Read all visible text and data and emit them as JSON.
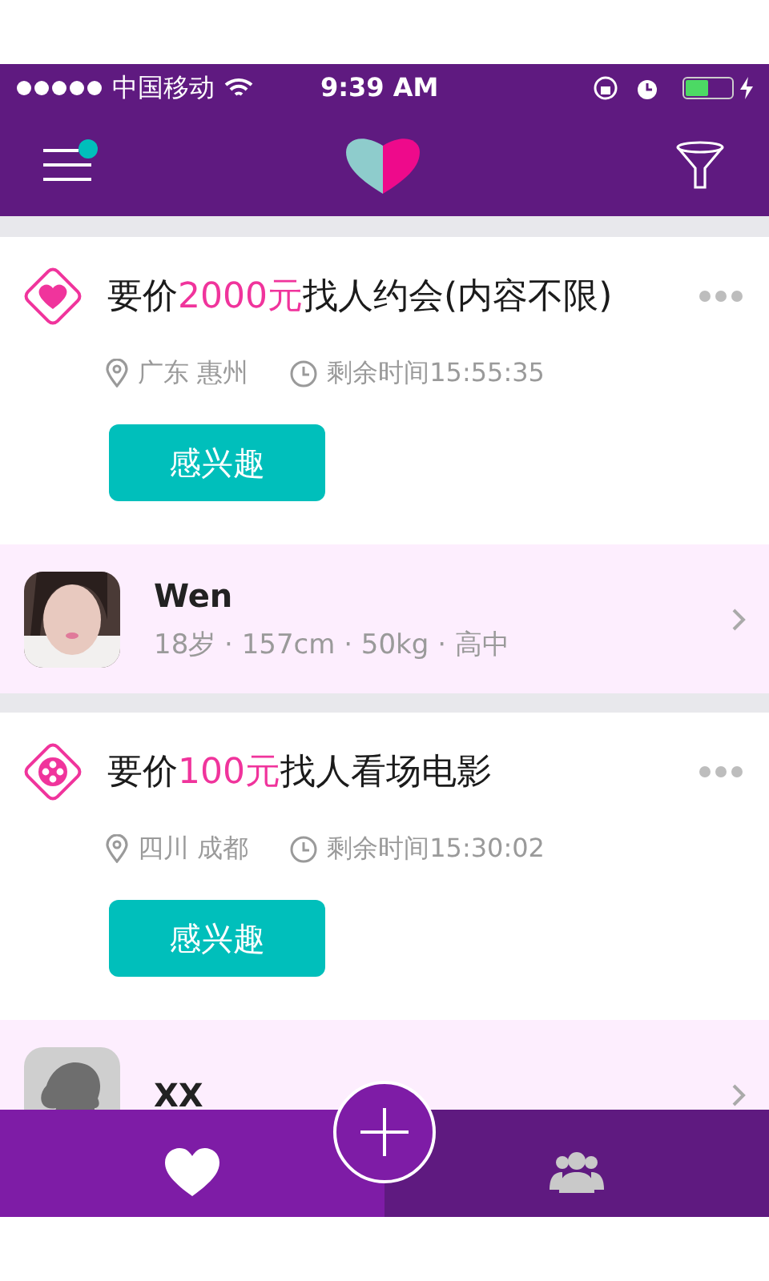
{
  "status_bar": {
    "carrier": "中国移动",
    "time": "9:39 AM"
  },
  "header": {
    "menu_badge": true
  },
  "posts": [
    {
      "kind": "heart",
      "title_prefix": "要价",
      "price": "2000元",
      "title_suffix": "找人约会(内容不限)",
      "location": "广东 惠州",
      "time_left": "剩余时间15:55:35",
      "button": "感兴趣",
      "user": {
        "kind": "picture",
        "name": "Wen",
        "details": "18岁 · 157cm · 50kg · 高中"
      }
    },
    {
      "kind": "film",
      "title_prefix": "要价",
      "price": "100元",
      "title_suffix": "找人看场电影",
      "location": "四川 成都",
      "time_left": "剩余时间15:30:02",
      "button": "感兴趣",
      "user": {
        "kind": "placeholder",
        "name": "XX"
      }
    }
  ],
  "tabs": [
    {
      "kind": "heart",
      "selected": true
    },
    {
      "kind": "people",
      "selected": false
    }
  ]
}
